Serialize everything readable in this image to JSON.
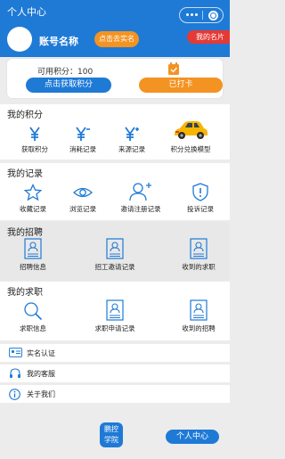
{
  "nav": {
    "title": "个人中心"
  },
  "profile": {
    "name": "账号名称",
    "verify_label": "点击去实名",
    "card_label": "我的名片"
  },
  "points_card": {
    "points_text": "可用积分：100",
    "get_points_label": "点击获取积分",
    "checkin_label": "已打卡"
  },
  "sections": {
    "points": {
      "title": "我的积分",
      "items": [
        "获取积分",
        "消耗记录",
        "来源记录",
        "积分兑换模型"
      ]
    },
    "records": {
      "title": "我的记录",
      "items": [
        "收藏记录",
        "浏览记录",
        "邀请注册记录",
        "投诉记录"
      ]
    },
    "recruit": {
      "title": "我的招聘",
      "items": [
        "招聘信息",
        "招工邀请记录",
        "收到的求职"
      ]
    },
    "jobseek": {
      "title": "我的求职",
      "items": [
        "求职信息",
        "求职申请记录",
        "收到的招聘"
      ]
    }
  },
  "list": [
    "实名认证",
    "我的客服",
    "关于我们"
  ],
  "bottom": {
    "fab_line1": "鹏控",
    "fab_line2": "学院",
    "center_label": "个人中心"
  },
  "colors": {
    "primary": "#1f7ad6",
    "orange": "#f39322",
    "red": "#e53935"
  }
}
